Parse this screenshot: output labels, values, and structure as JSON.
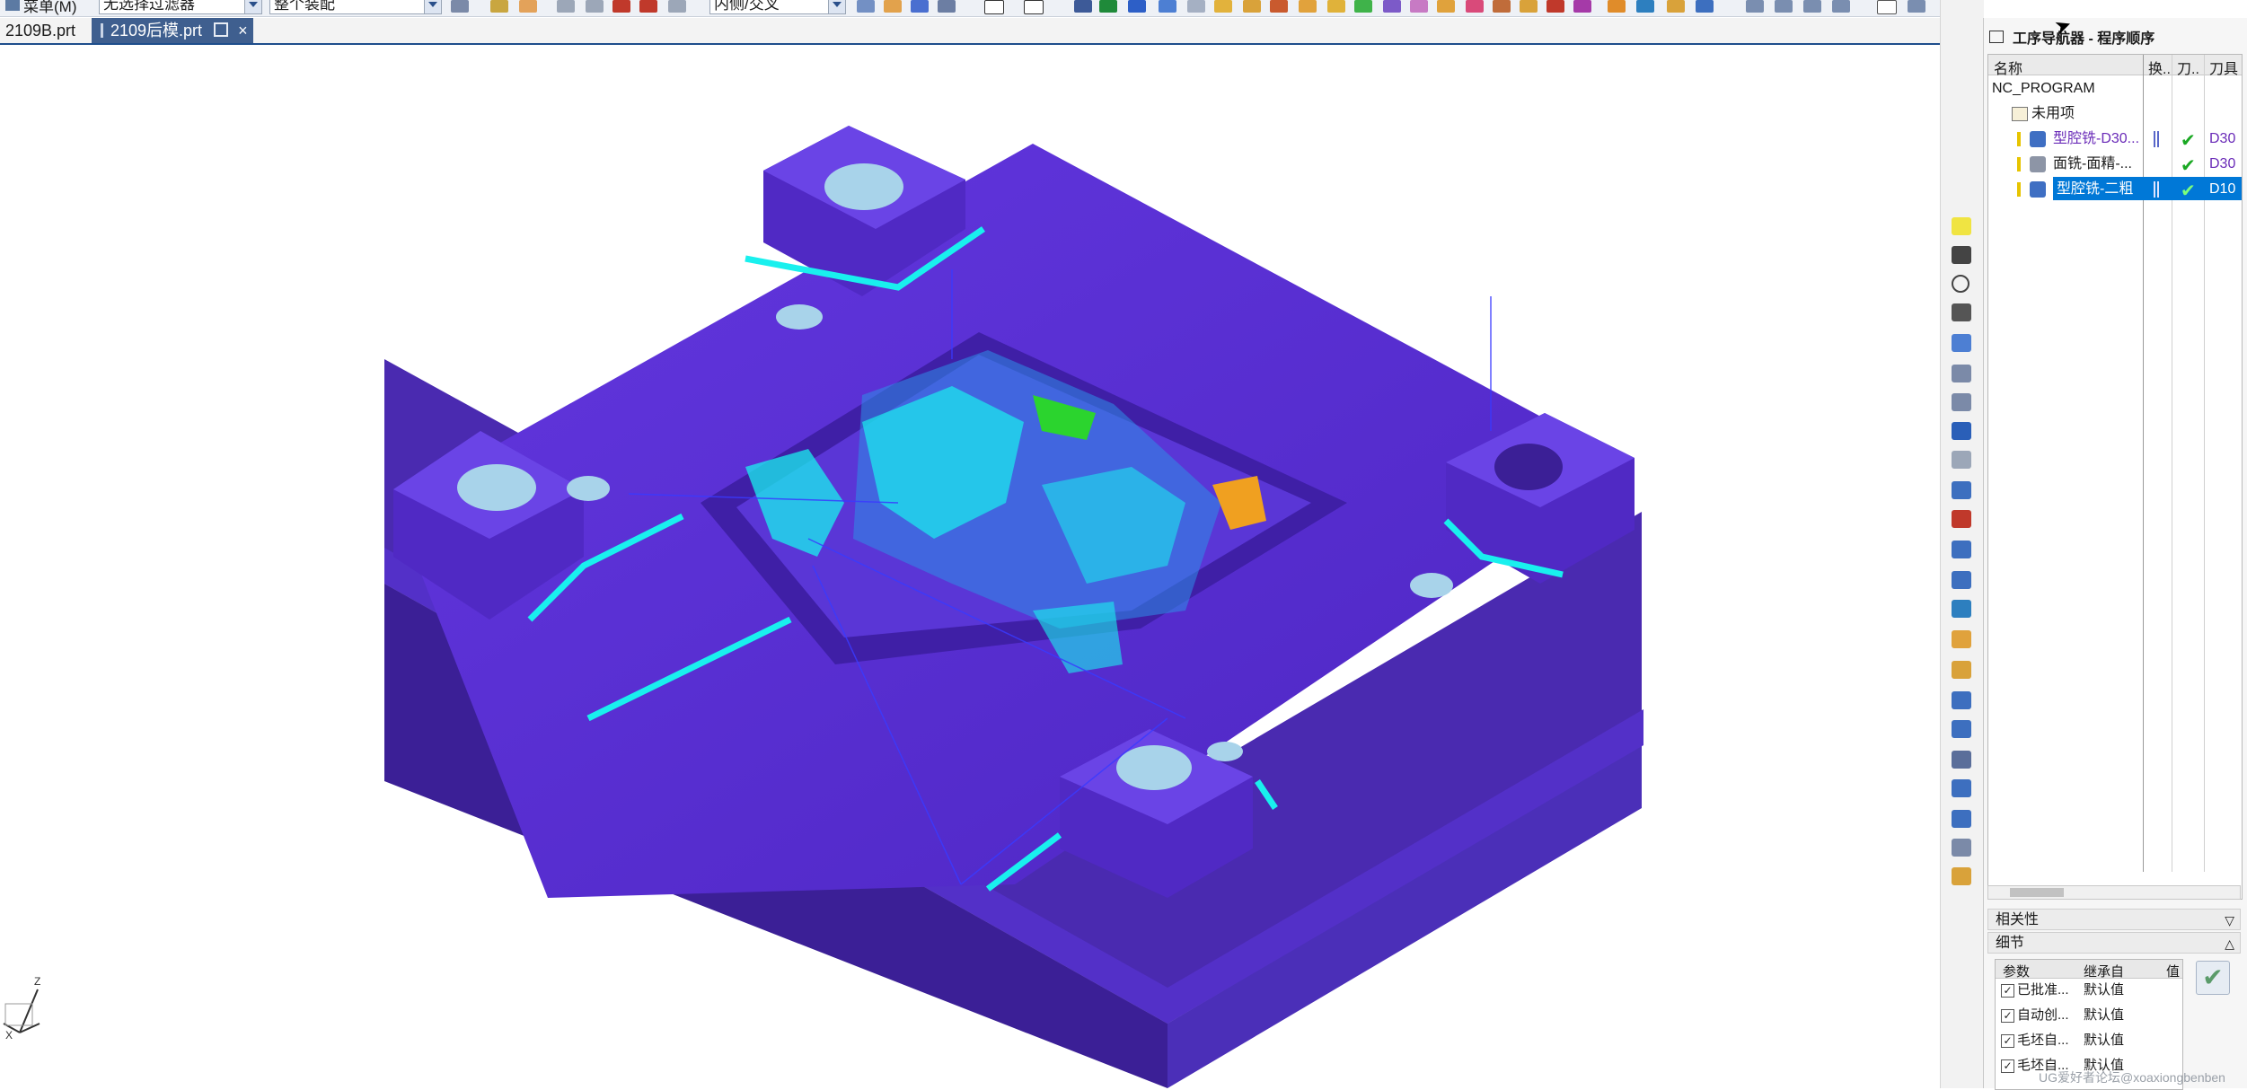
{
  "toolbar": {
    "menu_label": "菜单(M)",
    "selection_filter": "无选择过滤器",
    "assembly_scope": "整个装配",
    "snap_mode": "内侧/交叉"
  },
  "tabs": [
    {
      "label": "2109B.prt"
    },
    {
      "label": "2109后模.prt",
      "close": "×"
    }
  ],
  "navigator": {
    "title": "工序导航器 - 程序顺序",
    "columns": [
      "名称",
      "换..",
      "刀..",
      "刀具"
    ],
    "root": "NC_PROGRAM",
    "unused": "未用项",
    "operations": [
      {
        "name": "型腔铣-D30...",
        "tool": "D30",
        "selected": false,
        "icon": "cavity-mill-icon",
        "color": "#6a2bb8"
      },
      {
        "name": "面铣-面精-...",
        "tool": "D30",
        "selected": false,
        "icon": "face-mill-icon",
        "color": "#1a1a1a"
      },
      {
        "name": "型腔铣-二粗",
        "tool": "D10",
        "selected": true,
        "icon": "cavity-mill-icon",
        "color": "#ffffff"
      }
    ],
    "sections": {
      "dependencies": "相关性",
      "details": "细节"
    },
    "details_columns": [
      "参数",
      "继承自",
      "值"
    ],
    "details_rows": [
      {
        "param": "已批准...",
        "inherit": "默认值"
      },
      {
        "param": "自动创...",
        "inherit": "默认值"
      },
      {
        "param": "毛坯自...",
        "inherit": "默认值"
      },
      {
        "param": "毛坯自...",
        "inherit": "默认值"
      }
    ]
  },
  "triad": {
    "z": "Z",
    "x": "X"
  },
  "watermark": "UG爱好者论坛@xoaxiongbenben",
  "colors": {
    "part_body": "#5a2fd0",
    "part_side": "#4a24a8",
    "toolpath_cyan": "#19f0ee",
    "selection": "#0078d7",
    "tab_active": "#3f5f8f"
  }
}
